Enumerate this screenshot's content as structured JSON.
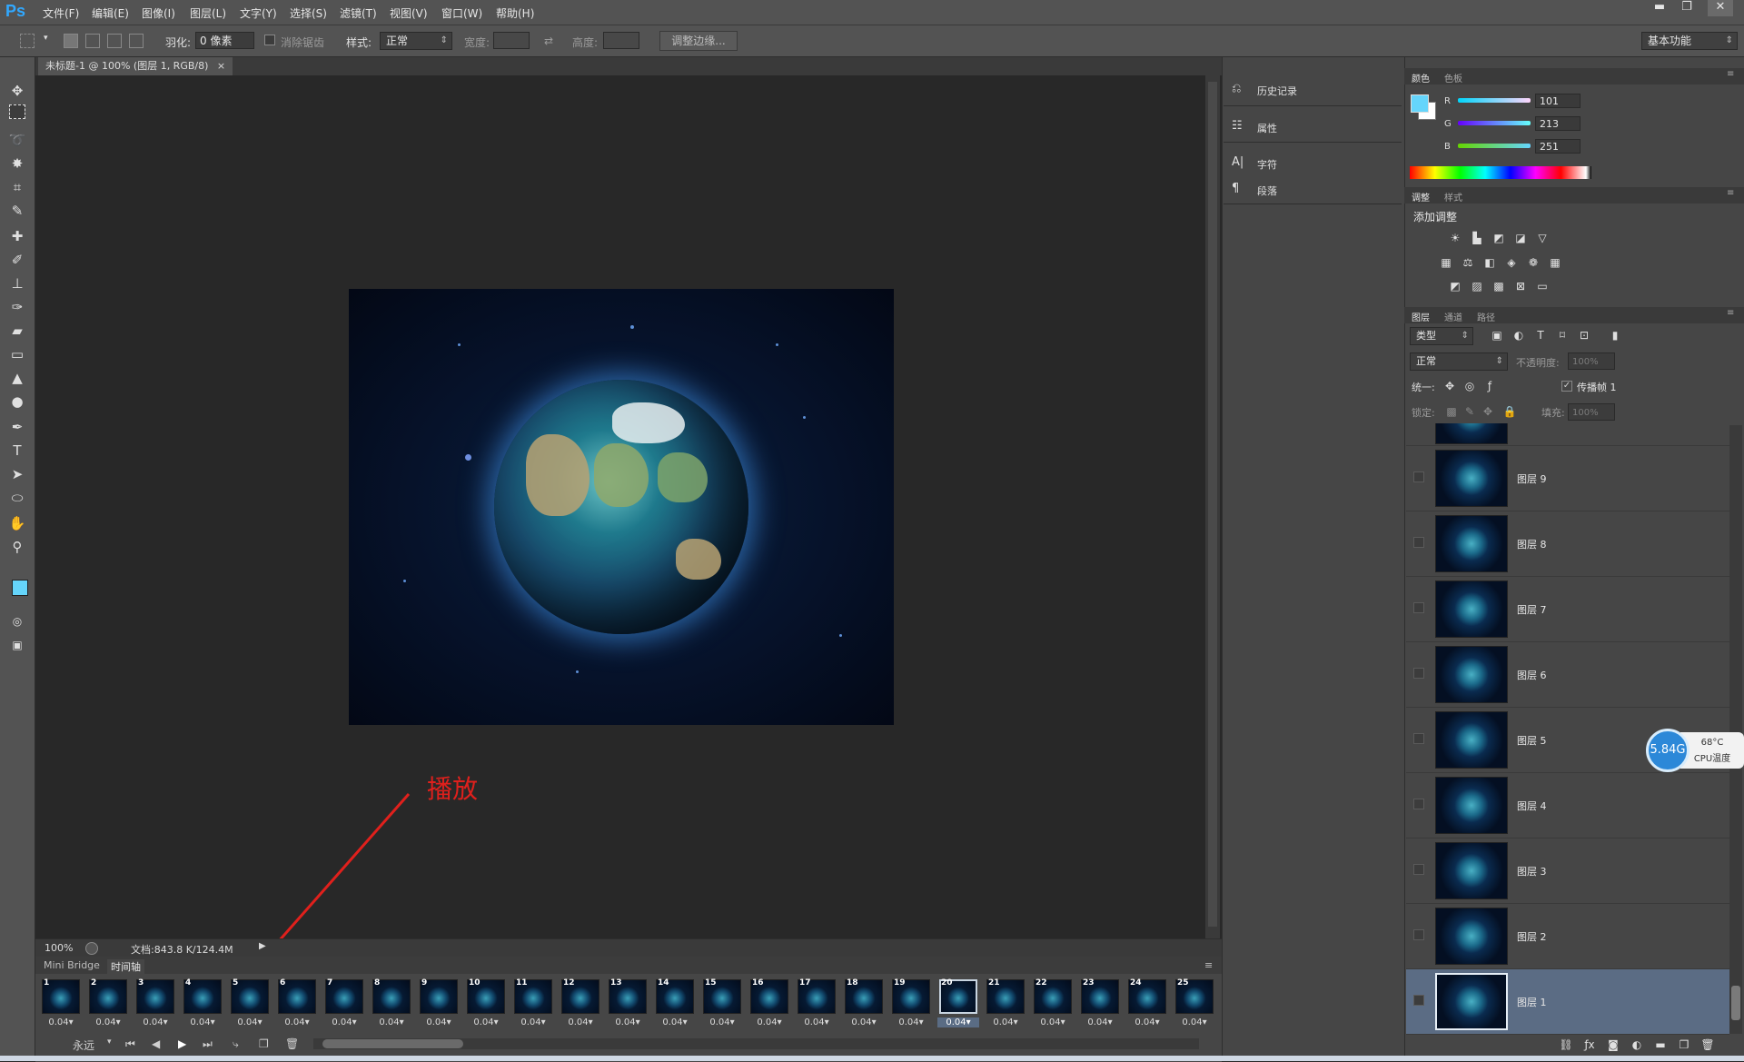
{
  "app": {
    "logo": "Ps",
    "accent": "#31a8ff"
  },
  "menu": [
    "文件(F)",
    "编辑(E)",
    "图像(I)",
    "图层(L)",
    "文字(Y)",
    "选择(S)",
    "滤镜(T)",
    "视图(V)",
    "窗口(W)",
    "帮助(H)"
  ],
  "window_controls": [
    "▬",
    "❐",
    "✕"
  ],
  "options": {
    "feather_label": "羽化:",
    "feather_value": "0 像素",
    "antialias_label": "消除锯齿",
    "style_label": "样式:",
    "style_value": "正常",
    "width_label": "宽度:",
    "height_label": "高度:",
    "refine_edge": "调整边缘...",
    "workspace": "基本功能"
  },
  "document": {
    "tab_title": "未标题-1 @ 100% (图层 1, RGB/8)",
    "zoom": "100%",
    "doc_info": "文档:843.8 K/124.4M"
  },
  "annotation": {
    "label": "播放",
    "color": "#e0201c"
  },
  "timeline": {
    "tabs": [
      "Mini Bridge",
      "时间轴"
    ],
    "frames": [
      {
        "num": "1",
        "dur": "0.04▾"
      },
      {
        "num": "2",
        "dur": "0.04▾"
      },
      {
        "num": "3",
        "dur": "0.04▾"
      },
      {
        "num": "4",
        "dur": "0.04▾"
      },
      {
        "num": "5",
        "dur": "0.04▾"
      },
      {
        "num": "6",
        "dur": "0.04▾"
      },
      {
        "num": "7",
        "dur": "0.04▾"
      },
      {
        "num": "8",
        "dur": "0.04▾"
      },
      {
        "num": "9",
        "dur": "0.04▾"
      },
      {
        "num": "10",
        "dur": "0.04▾"
      },
      {
        "num": "11",
        "dur": "0.04▾"
      },
      {
        "num": "12",
        "dur": "0.04▾"
      },
      {
        "num": "13",
        "dur": "0.04▾"
      },
      {
        "num": "14",
        "dur": "0.04▾"
      },
      {
        "num": "15",
        "dur": "0.04▾"
      },
      {
        "num": "16",
        "dur": "0.04▾"
      },
      {
        "num": "17",
        "dur": "0.04▾"
      },
      {
        "num": "18",
        "dur": "0.04▾"
      },
      {
        "num": "19",
        "dur": "0.04▾"
      },
      {
        "num": "20",
        "dur": "0.04▾"
      },
      {
        "num": "21",
        "dur": "0.04▾"
      },
      {
        "num": "22",
        "dur": "0.04▾"
      },
      {
        "num": "23",
        "dur": "0.04▾"
      },
      {
        "num": "24",
        "dur": "0.04▾"
      },
      {
        "num": "25",
        "dur": "0.04▾"
      }
    ],
    "selected_frame": "20",
    "loop": "永远",
    "controls": [
      "⏮",
      "◀",
      "▶",
      "⏭"
    ]
  },
  "mid_panels": [
    "历史记录",
    "属性",
    "字符",
    "段落"
  ],
  "color_panel": {
    "tabs": [
      "颜色",
      "色板"
    ],
    "r_label": "R",
    "g_label": "G",
    "b_label": "B",
    "r": "101",
    "g": "213",
    "b": "251",
    "foreground": "#65d5fb"
  },
  "adjust_panel": {
    "tabs": [
      "调整",
      "样式"
    ],
    "title": "添加调整"
  },
  "layers_panel": {
    "tabs": [
      "图层",
      "通道",
      "路径"
    ],
    "filter": "类型",
    "blend_mode": "正常",
    "opacity_label": "不透明度:",
    "opacity_value": "100%",
    "unify_label": "统一:",
    "propagate_label": "传播帧 1",
    "lock_label": "锁定:",
    "fill_label": "填充:",
    "fill_value": "100%",
    "layers": [
      "图层 9",
      "图层 8",
      "图层 7",
      "图层 6",
      "图层 5",
      "图层 4",
      "图层 3",
      "图层 2",
      "图层 1"
    ],
    "selected": "图层 1"
  },
  "cpu_widget": {
    "memory": "5.84G",
    "temp": "68°C",
    "label": "CPU温度"
  }
}
